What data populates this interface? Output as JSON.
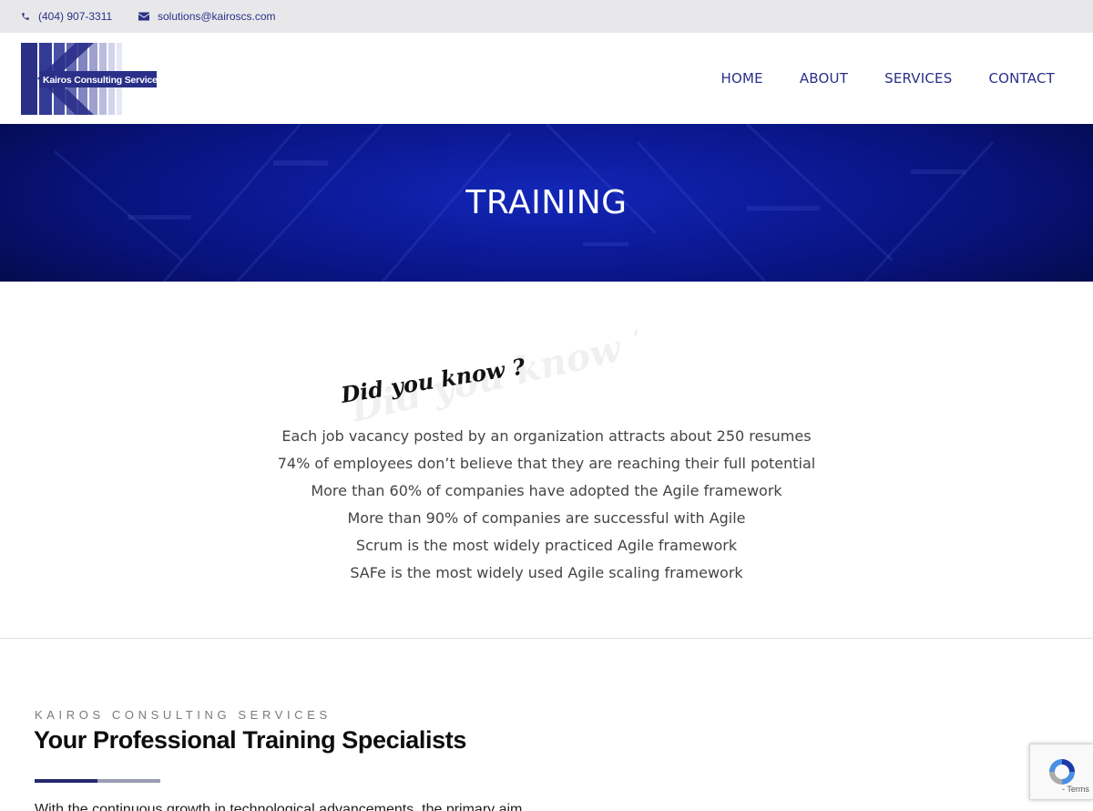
{
  "topbar": {
    "phone": "(404) 907-3311",
    "email": "solutions@kairoscs.com"
  },
  "logo": {
    "text": "Kairos Consulting Services",
    "letter": "K"
  },
  "nav": {
    "items": [
      "HOME",
      "ABOUT",
      "SERVICES",
      "CONTACT"
    ]
  },
  "hero": {
    "title": "TRAINING"
  },
  "did_you_know": {
    "text": "Did you know ?"
  },
  "facts": [
    "Each job vacancy posted by an organization attracts about 250 resumes",
    "74% of employees don’t believe that they are reaching their full potential",
    "More than 60% of companies have adopted the Agile framework",
    "More than 90% of companies are successful with Agile",
    "Scrum is the most widely practiced Agile framework",
    "SAFe is the most widely used Agile scaling framework"
  ],
  "intro": {
    "eyebrow": "KAIROS CONSULTING SERVICES",
    "heading": "Your Professional Training Specialists",
    "body": "With the continuous growth in technological advancements, the primary aim"
  },
  "recaptcha": {
    "terms": "- Terms"
  },
  "colors": {
    "brand_navy": "#2a2f88",
    "hero_blue": "#0c1a98",
    "topbar_bg": "#e8e8ea"
  }
}
